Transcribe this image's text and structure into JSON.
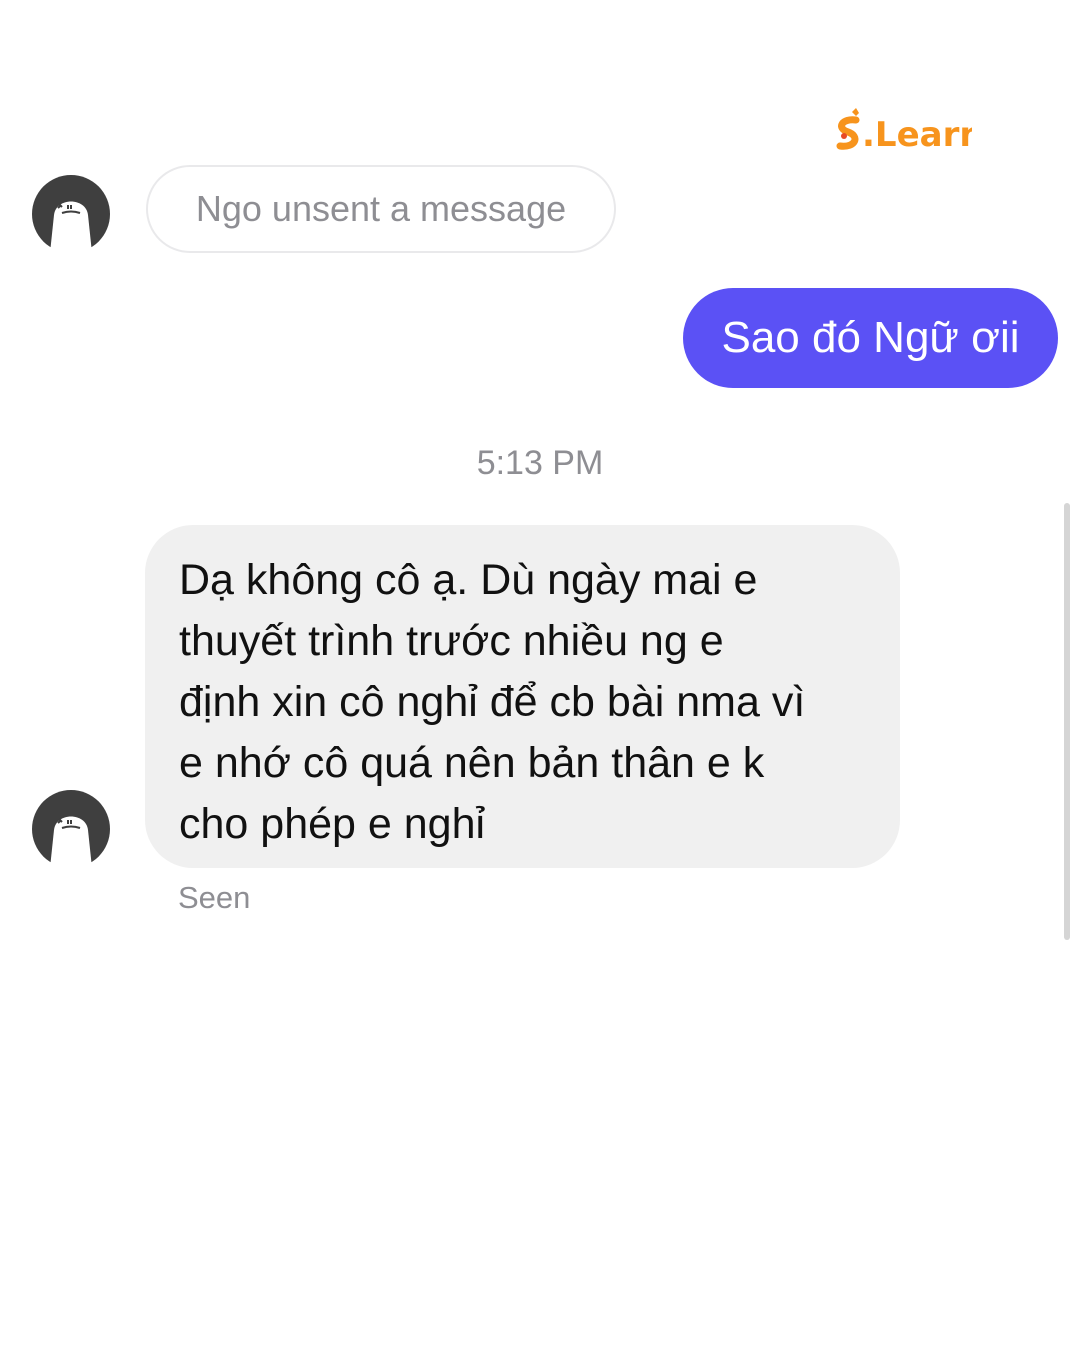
{
  "watermark": {
    "text": "S.Learn",
    "color": "#f7941d"
  },
  "conversation": {
    "unsent_notice": "Ngo unsent a message",
    "sent_message": "Sao đó Ngữ ơii",
    "timestamp": "5:13 PM",
    "received_message": {
      "lines": [
        "Dạ không cô ạ. Dù ngày mai e",
        "thuyết trình trước nhiều ng e",
        "định xin cô nghỉ để cb bài nma vì",
        "e nhớ cô quá nên bản thân e k",
        "cho phép e nghỉ"
      ]
    },
    "read_receipt": "Seen"
  },
  "colors": {
    "sent_bubble": "#5b51f5",
    "received_bubble": "#f0f0f0",
    "meta_text": "#8e8e93"
  },
  "icons": {
    "avatar": "ghost-face-avatar-icon"
  }
}
